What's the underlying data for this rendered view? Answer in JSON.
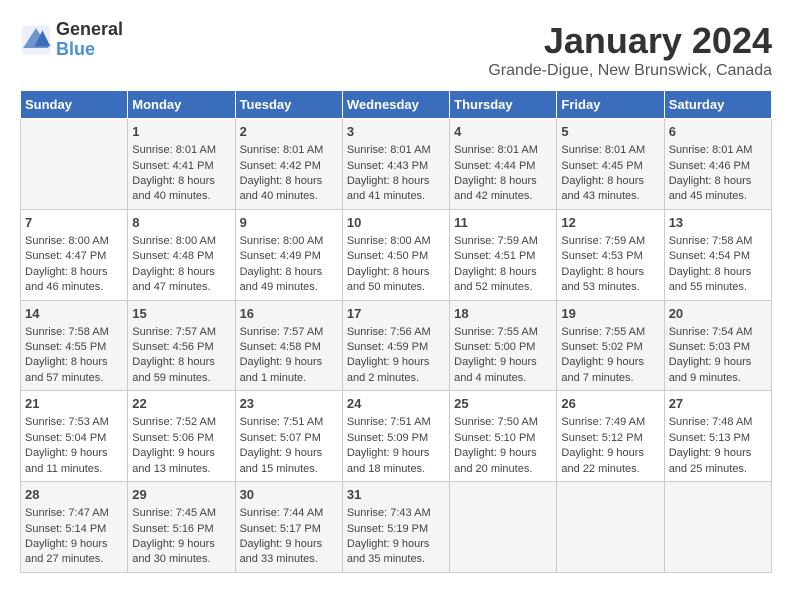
{
  "header": {
    "logo_line1": "General",
    "logo_line2": "Blue",
    "title": "January 2024",
    "subtitle": "Grande-Digue, New Brunswick, Canada"
  },
  "weekdays": [
    "Sunday",
    "Monday",
    "Tuesday",
    "Wednesday",
    "Thursday",
    "Friday",
    "Saturday"
  ],
  "weeks": [
    [
      {
        "day": "",
        "data": ""
      },
      {
        "day": "1",
        "data": "Sunrise: 8:01 AM\nSunset: 4:41 PM\nDaylight: 8 hours\nand 40 minutes."
      },
      {
        "day": "2",
        "data": "Sunrise: 8:01 AM\nSunset: 4:42 PM\nDaylight: 8 hours\nand 40 minutes."
      },
      {
        "day": "3",
        "data": "Sunrise: 8:01 AM\nSunset: 4:43 PM\nDaylight: 8 hours\nand 41 minutes."
      },
      {
        "day": "4",
        "data": "Sunrise: 8:01 AM\nSunset: 4:44 PM\nDaylight: 8 hours\nand 42 minutes."
      },
      {
        "day": "5",
        "data": "Sunrise: 8:01 AM\nSunset: 4:45 PM\nDaylight: 8 hours\nand 43 minutes."
      },
      {
        "day": "6",
        "data": "Sunrise: 8:01 AM\nSunset: 4:46 PM\nDaylight: 8 hours\nand 45 minutes."
      }
    ],
    [
      {
        "day": "7",
        "data": "Sunrise: 8:00 AM\nSunset: 4:47 PM\nDaylight: 8 hours\nand 46 minutes."
      },
      {
        "day": "8",
        "data": "Sunrise: 8:00 AM\nSunset: 4:48 PM\nDaylight: 8 hours\nand 47 minutes."
      },
      {
        "day": "9",
        "data": "Sunrise: 8:00 AM\nSunset: 4:49 PM\nDaylight: 8 hours\nand 49 minutes."
      },
      {
        "day": "10",
        "data": "Sunrise: 8:00 AM\nSunset: 4:50 PM\nDaylight: 8 hours\nand 50 minutes."
      },
      {
        "day": "11",
        "data": "Sunrise: 7:59 AM\nSunset: 4:51 PM\nDaylight: 8 hours\nand 52 minutes."
      },
      {
        "day": "12",
        "data": "Sunrise: 7:59 AM\nSunset: 4:53 PM\nDaylight: 8 hours\nand 53 minutes."
      },
      {
        "day": "13",
        "data": "Sunrise: 7:58 AM\nSunset: 4:54 PM\nDaylight: 8 hours\nand 55 minutes."
      }
    ],
    [
      {
        "day": "14",
        "data": "Sunrise: 7:58 AM\nSunset: 4:55 PM\nDaylight: 8 hours\nand 57 minutes."
      },
      {
        "day": "15",
        "data": "Sunrise: 7:57 AM\nSunset: 4:56 PM\nDaylight: 8 hours\nand 59 minutes."
      },
      {
        "day": "16",
        "data": "Sunrise: 7:57 AM\nSunset: 4:58 PM\nDaylight: 9 hours\nand 1 minute."
      },
      {
        "day": "17",
        "data": "Sunrise: 7:56 AM\nSunset: 4:59 PM\nDaylight: 9 hours\nand 2 minutes."
      },
      {
        "day": "18",
        "data": "Sunrise: 7:55 AM\nSunset: 5:00 PM\nDaylight: 9 hours\nand 4 minutes."
      },
      {
        "day": "19",
        "data": "Sunrise: 7:55 AM\nSunset: 5:02 PM\nDaylight: 9 hours\nand 7 minutes."
      },
      {
        "day": "20",
        "data": "Sunrise: 7:54 AM\nSunset: 5:03 PM\nDaylight: 9 hours\nand 9 minutes."
      }
    ],
    [
      {
        "day": "21",
        "data": "Sunrise: 7:53 AM\nSunset: 5:04 PM\nDaylight: 9 hours\nand 11 minutes."
      },
      {
        "day": "22",
        "data": "Sunrise: 7:52 AM\nSunset: 5:06 PM\nDaylight: 9 hours\nand 13 minutes."
      },
      {
        "day": "23",
        "data": "Sunrise: 7:51 AM\nSunset: 5:07 PM\nDaylight: 9 hours\nand 15 minutes."
      },
      {
        "day": "24",
        "data": "Sunrise: 7:51 AM\nSunset: 5:09 PM\nDaylight: 9 hours\nand 18 minutes."
      },
      {
        "day": "25",
        "data": "Sunrise: 7:50 AM\nSunset: 5:10 PM\nDaylight: 9 hours\nand 20 minutes."
      },
      {
        "day": "26",
        "data": "Sunrise: 7:49 AM\nSunset: 5:12 PM\nDaylight: 9 hours\nand 22 minutes."
      },
      {
        "day": "27",
        "data": "Sunrise: 7:48 AM\nSunset: 5:13 PM\nDaylight: 9 hours\nand 25 minutes."
      }
    ],
    [
      {
        "day": "28",
        "data": "Sunrise: 7:47 AM\nSunset: 5:14 PM\nDaylight: 9 hours\nand 27 minutes."
      },
      {
        "day": "29",
        "data": "Sunrise: 7:45 AM\nSunset: 5:16 PM\nDaylight: 9 hours\nand 30 minutes."
      },
      {
        "day": "30",
        "data": "Sunrise: 7:44 AM\nSunset: 5:17 PM\nDaylight: 9 hours\nand 33 minutes."
      },
      {
        "day": "31",
        "data": "Sunrise: 7:43 AM\nSunset: 5:19 PM\nDaylight: 9 hours\nand 35 minutes."
      },
      {
        "day": "",
        "data": ""
      },
      {
        "day": "",
        "data": ""
      },
      {
        "day": "",
        "data": ""
      }
    ]
  ]
}
